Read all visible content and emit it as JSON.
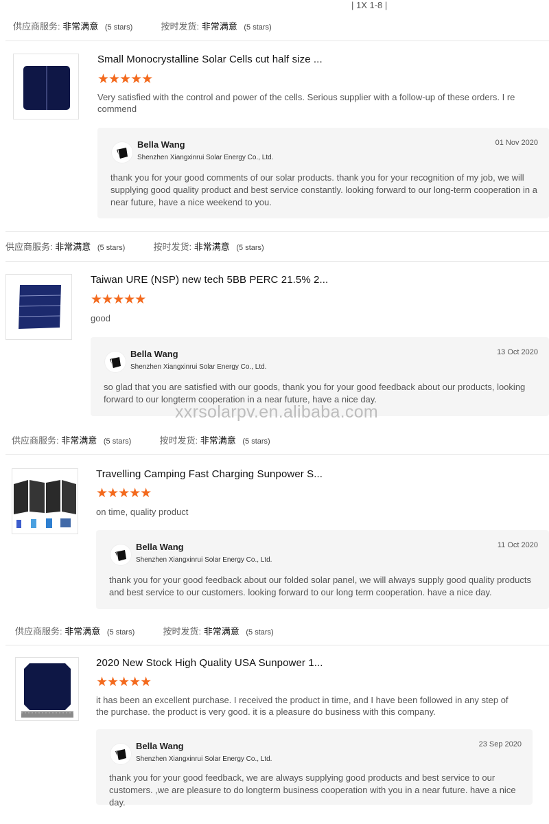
{
  "top_fragment": "| 1X 1-8 |",
  "watermark": "xxrsolarpv.en.alibaba.com",
  "rating_labels": {
    "service_label": "供应商服务:",
    "delivery_label": "按时发货:",
    "value": "非常满意",
    "stars_text": "(5 stars)"
  },
  "reviews": [
    {
      "title": "Small Monocrystalline Solar Cells cut half size ...",
      "stars": 5,
      "comment": "Very satisfied with the control and power of the cells. Serious supplier with a follow-up of these orders. I re commend",
      "reply": {
        "name": "Bella Wang",
        "company": "Shenzhen Xiangxinrui Solar Energy Co., Ltd.",
        "date": "01 Nov 2020",
        "text": "thank you for your good comments of our solar products. thank you for your recognition of my job, we will supplying good quality product and best service constantly.  looking forward to our long-term cooperation in a near future, have a nice weekend to you."
      }
    },
    {
      "title": "Taiwan URE (NSP) new tech 5BB PERC 21.5% 2...",
      "stars": 5,
      "comment": "good",
      "reply": {
        "name": "Bella Wang",
        "company": "Shenzhen Xiangxinrui Solar Energy Co., Ltd.",
        "date": "13 Oct 2020",
        "text": "so glad that you are satisfied with our goods, thank you for your good feedback about our products, looking forward to our longterm cooperation in a near future, have a nice day."
      }
    },
    {
      "title": "Travelling Camping Fast Charging Sunpower S...",
      "stars": 5,
      "comment": "on time, quality product",
      "reply": {
        "name": "Bella Wang",
        "company": "Shenzhen Xiangxinrui Solar Energy Co., Ltd.",
        "date": "11 Oct 2020",
        "text": "thank you for your good feedback about our folded solar panel, we will always supply good quality products and best service  to our customers. looking forward to our long term cooperation. have a nice day."
      }
    },
    {
      "title": "2020 New Stock High Quality USA Sunpower 1...",
      "stars": 5,
      "comment": "it has been an excellent purchase. I received the product in time, and I have been followed in any step of the purchase. the product is very good. it is a pleasure do business with this company.",
      "reply": {
        "name": "Bella Wang",
        "company": "Shenzhen Xiangxinrui Solar Energy Co., Ltd.",
        "date": "23 Sep 2020",
        "text": "thank you for your good feedback, we are always supplying good products and best service to our customers. ,we are pleasure to do longterm business cooperation with you in a near future. have a nice day."
      }
    }
  ],
  "star_color": "#f36a1e"
}
